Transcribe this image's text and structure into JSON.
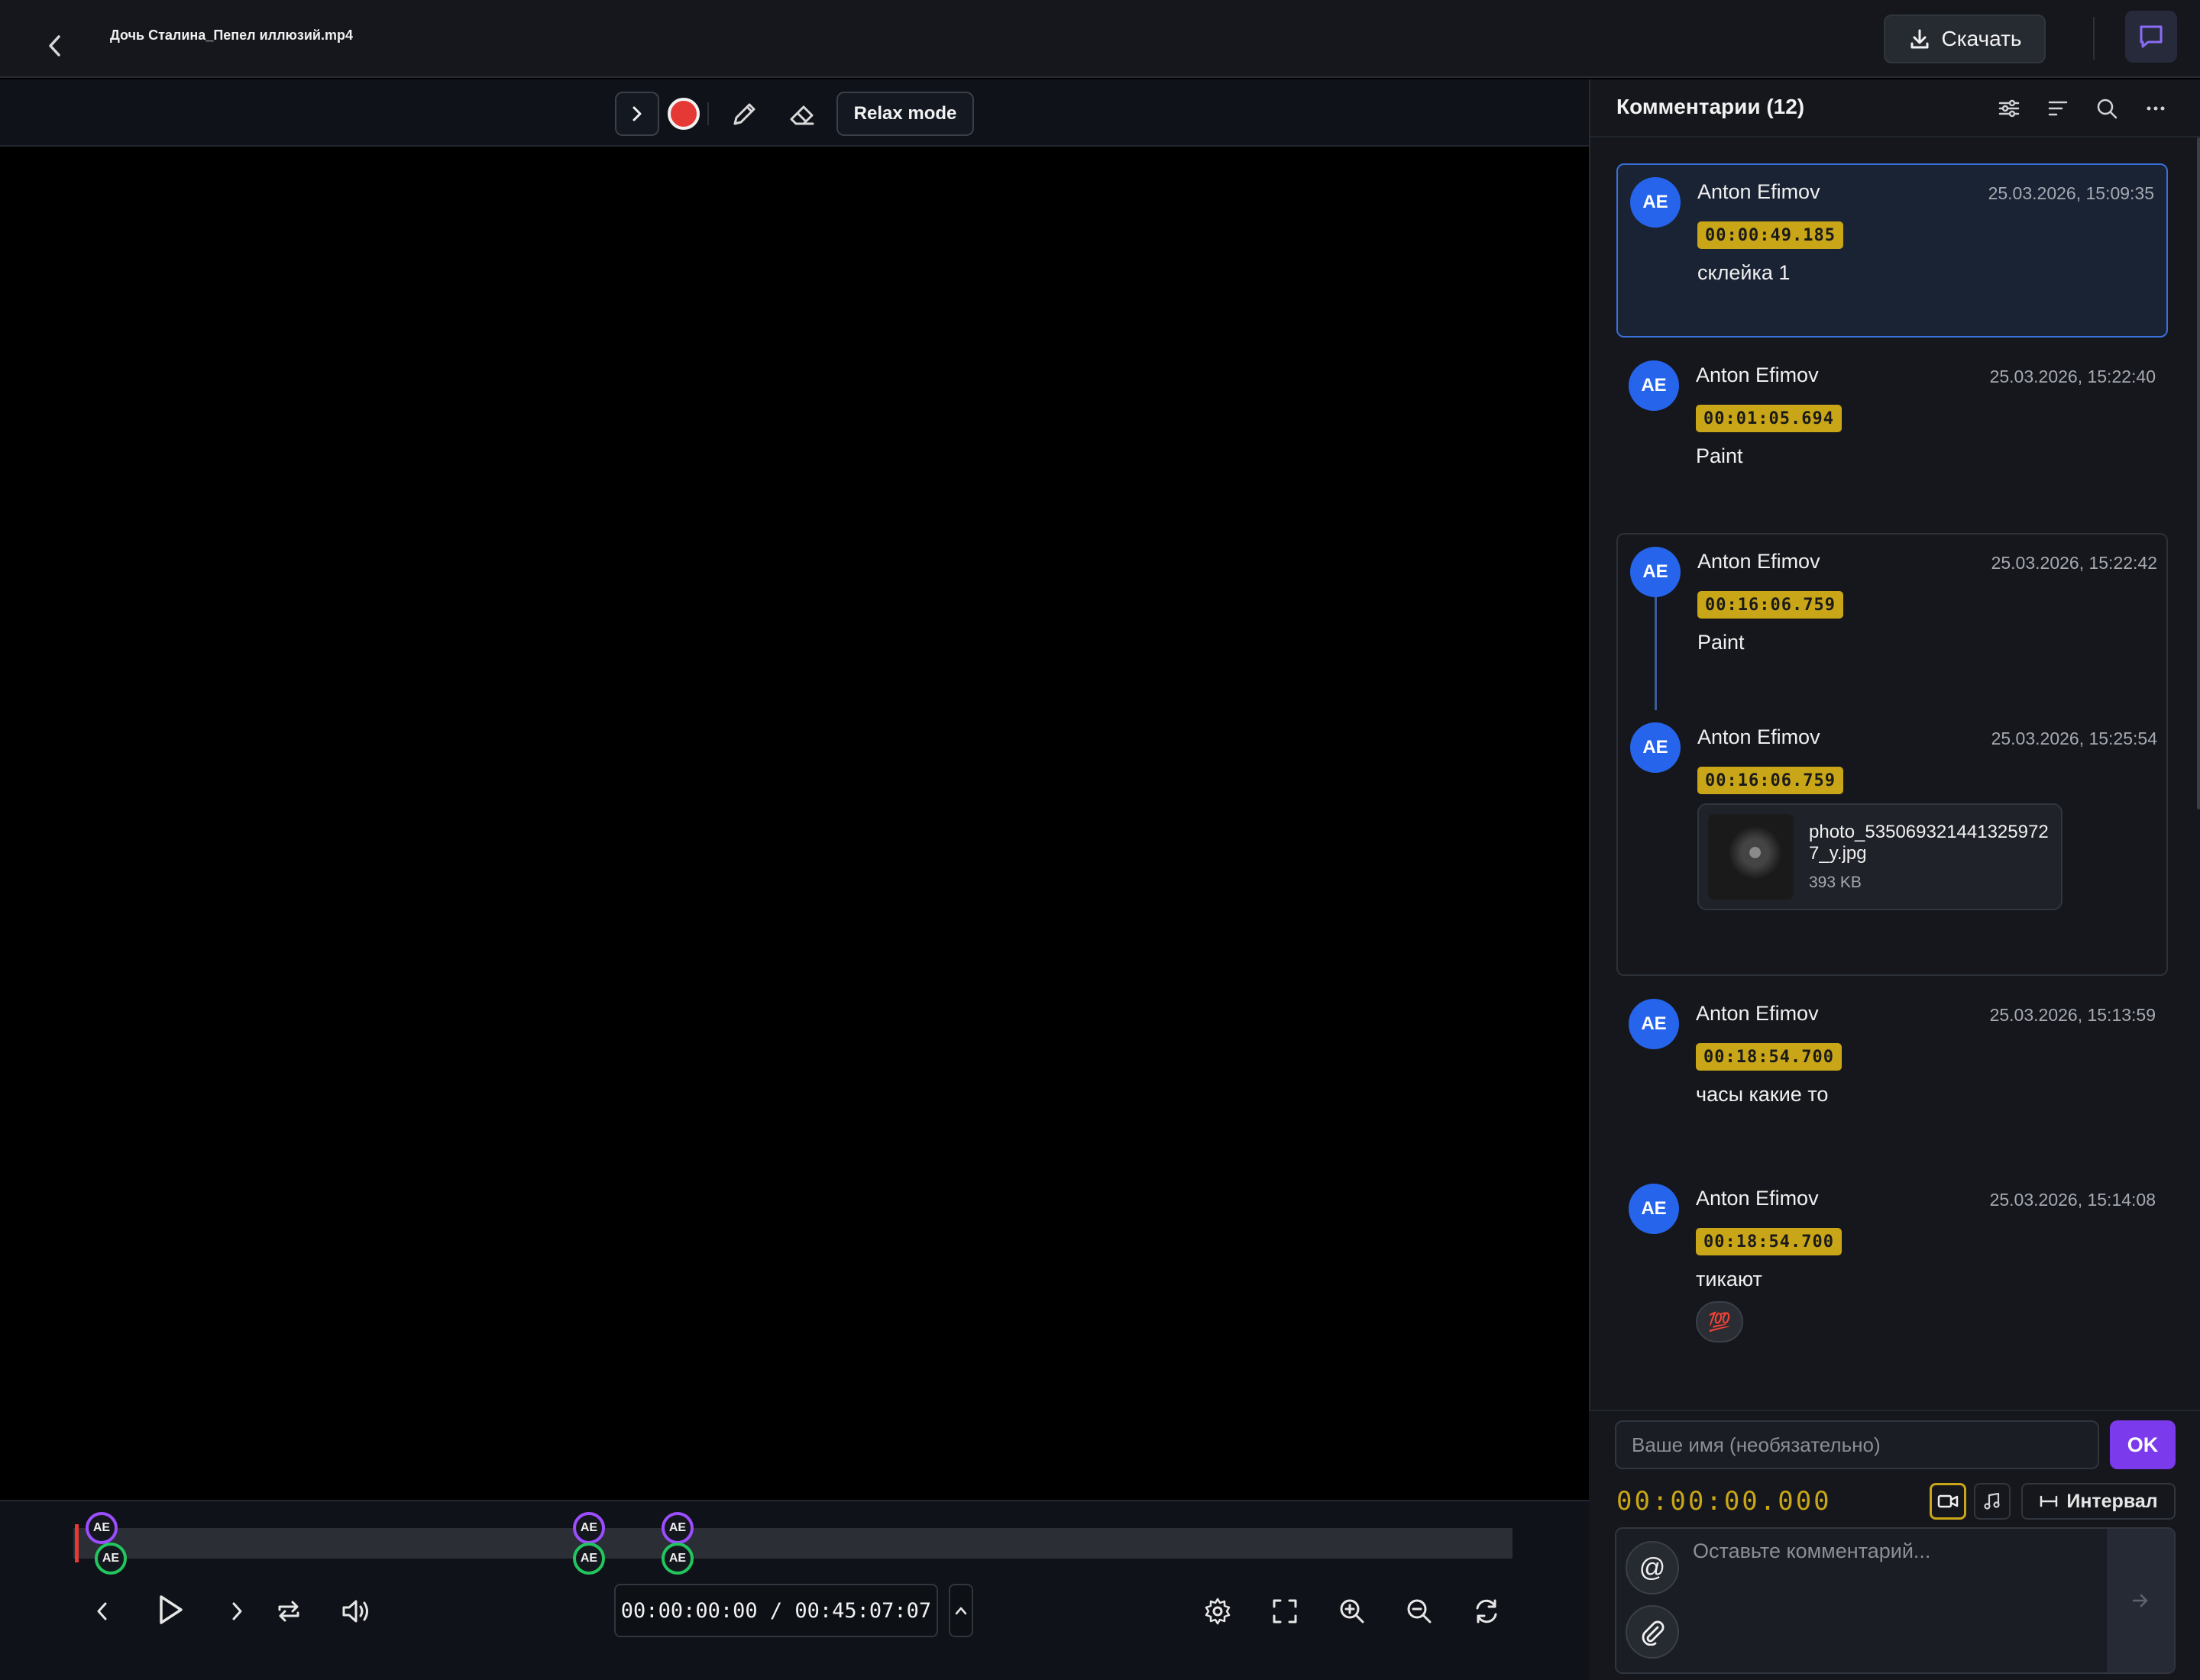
{
  "header": {
    "file_title": "Дочь Сталина_Пепел иллюзий.mp4",
    "download_label": "Скачать"
  },
  "toolbar": {
    "brush_color": "#e53935",
    "relax_label": "Relax mode"
  },
  "player": {
    "timecode": "00:00:00:00 / 00:45:07:07",
    "markers": [
      {
        "label": "AE",
        "color": "purple"
      },
      {
        "label": "AE",
        "color": "green"
      },
      {
        "label": "AE",
        "color": "purple"
      },
      {
        "label": "AE",
        "color": "green"
      },
      {
        "label": "AE",
        "color": "purple"
      },
      {
        "label": "AE",
        "color": "green"
      }
    ]
  },
  "sidebar": {
    "title": "Комментарии (12)",
    "comments": [
      {
        "initials": "AE",
        "author": "Anton Efimov",
        "date": "25.03.2026, 15:09:35",
        "timecode": "00:00:49.185",
        "text": "склейка 1"
      },
      {
        "initials": "AE",
        "author": "Anton Efimov",
        "date": "25.03.2026, 15:22:40",
        "timecode": "00:01:05.694",
        "text": "Paint"
      },
      {
        "initials": "AE",
        "author": "Anton Efimov",
        "date": "25.03.2026, 15:22:42",
        "timecode": "00:16:06.759",
        "text": "Paint"
      },
      {
        "initials": "AE",
        "author": "Anton Efimov",
        "date": "25.03.2026, 15:25:54",
        "timecode": "00:16:06.759",
        "text": "",
        "attachment": {
          "name": "photo_5350693214413259727_y.jpg",
          "size": "393 KB"
        }
      },
      {
        "initials": "AE",
        "author": "Anton Efimov",
        "date": "25.03.2026, 15:13:59",
        "timecode": "00:18:54.700",
        "text": "часы какие то"
      },
      {
        "initials": "AE",
        "author": "Anton Efimov",
        "date": "25.03.2026, 15:14:08",
        "timecode": "00:18:54.700",
        "text": "тикают",
        "reaction": "💯"
      }
    ]
  },
  "composer": {
    "name_placeholder": "Ваше имя (необязательно)",
    "ok_label": "OK",
    "timecode": "00:00:00.000",
    "interval_label": "Интервал",
    "comment_placeholder": "Оставьте комментарий...",
    "mention_symbol": "@"
  },
  "colors": {
    "accent": "#7c3aed",
    "avatar": "#2664eb",
    "timecode_badge": "#c9a618",
    "selected_border": "#3b6fd9"
  }
}
